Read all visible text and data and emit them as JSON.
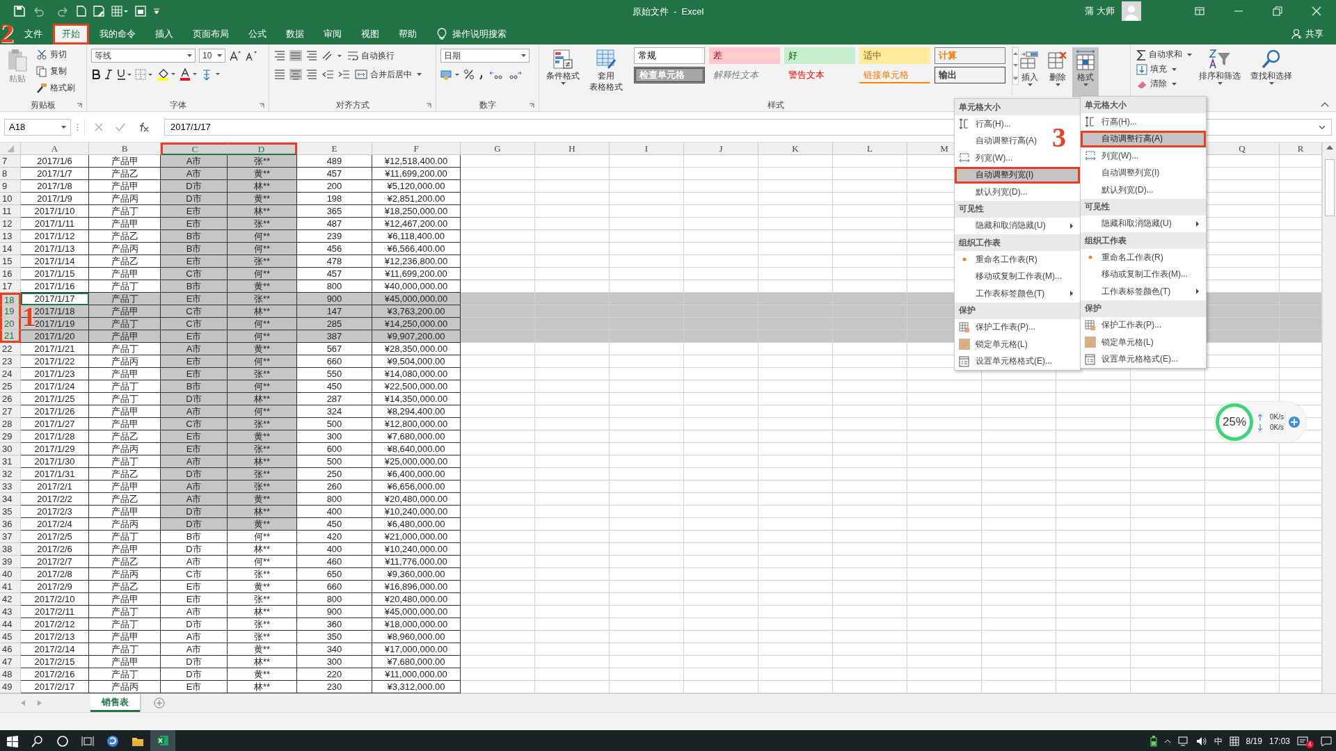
{
  "title_bar": {
    "document_title": "原始文件  -  Excel",
    "user": "蒲 大师"
  },
  "ribbon_tabs": [
    {
      "label": "文件",
      "selected": false
    },
    {
      "label": "开始",
      "selected": true
    },
    {
      "label": "我的命令",
      "selected": false
    },
    {
      "label": "插入",
      "selected": false
    },
    {
      "label": "页面布局",
      "selected": false
    },
    {
      "label": "公式",
      "selected": false
    },
    {
      "label": "数据",
      "selected": false
    },
    {
      "label": "审阅",
      "selected": false
    },
    {
      "label": "视图",
      "selected": false
    },
    {
      "label": "帮助",
      "selected": false
    }
  ],
  "tell_me": "操作说明搜索",
  "share": "共享",
  "ribbon": {
    "clipboard": {
      "paste": "粘贴",
      "cut": "剪切",
      "copy": "复制",
      "format_painter": "格式刷",
      "label": "剪贴板"
    },
    "font": {
      "name": "等线",
      "size": "10",
      "label": "字体"
    },
    "alignment": {
      "wrap_text": "自动换行",
      "merge_center": "合并后居中",
      "label": "对齐方式"
    },
    "number": {
      "format": "日期",
      "label": "数字"
    },
    "styles": {
      "conditional_formatting": "条件格式",
      "format_as_table": [
        "套用",
        "表格格式"
      ],
      "label": "样式",
      "gallery": [
        {
          "label": "常规",
          "kind": "normal"
        },
        {
          "label": "差",
          "kind": "bad"
        },
        {
          "label": "好",
          "kind": "good"
        },
        {
          "label": "适中",
          "kind": "neutral"
        },
        {
          "label": "计算",
          "kind": "calculation"
        },
        {
          "label": "检查单元格",
          "kind": "check"
        },
        {
          "label": "解释性文本",
          "kind": "explanatory"
        },
        {
          "label": "警告文本",
          "kind": "warning"
        },
        {
          "label": "链接单元格",
          "kind": "linked"
        },
        {
          "label": "输出",
          "kind": "output"
        }
      ]
    },
    "cells": [
      {
        "label": "插入",
        "selected": false
      },
      {
        "label": "删除",
        "selected": false
      },
      {
        "label": "格式",
        "selected": true
      }
    ],
    "editing": {
      "autosum": "自动求和",
      "fill": "填充",
      "clear": "清除",
      "sort_filter": "排序和筛选",
      "find_select": "查找和选择"
    }
  },
  "formula_bar": {
    "name_box": "A18",
    "formula": "2017/1/17"
  },
  "columns": [
    {
      "label": "A",
      "selected": false
    },
    {
      "label": "B",
      "selected": false
    },
    {
      "label": "C",
      "selected": true
    },
    {
      "label": "D",
      "selected": true
    },
    {
      "label": "E",
      "selected": false
    },
    {
      "label": "F",
      "selected": false
    },
    {
      "label": "G",
      "selected": false
    },
    {
      "label": "H",
      "selected": false
    },
    {
      "label": "I",
      "selected": false
    },
    {
      "label": "J",
      "selected": false
    },
    {
      "label": "K",
      "selected": false
    },
    {
      "label": "L",
      "selected": false
    },
    {
      "label": "M",
      "selected": false
    },
    {
      "label": "Q",
      "selected": false
    },
    {
      "label": "R",
      "selected": false
    }
  ],
  "rows": [
    {
      "number": "7",
      "cells": [
        "2017/1/6",
        "产品甲",
        "A市",
        "张**",
        "489",
        "¥12,518,400.00"
      ],
      "selected": false,
      "in_range": true,
      "active": false
    },
    {
      "number": "8",
      "cells": [
        "2017/1/7",
        "产品乙",
        "A市",
        "黄**",
        "457",
        "¥11,699,200.00"
      ],
      "selected": false,
      "in_range": true,
      "active": false
    },
    {
      "number": "9",
      "cells": [
        "2017/1/8",
        "产品甲",
        "D市",
        "林**",
        "200",
        "¥5,120,000.00"
      ],
      "selected": false,
      "in_range": true,
      "active": false
    },
    {
      "number": "10",
      "cells": [
        "2017/1/9",
        "产品丙",
        "D市",
        "黄**",
        "198",
        "¥2,851,200.00"
      ],
      "selected": false,
      "in_range": true,
      "active": false
    },
    {
      "number": "11",
      "cells": [
        "2017/1/10",
        "产品丁",
        "E市",
        "林**",
        "365",
        "¥18,250,000.00"
      ],
      "selected": false,
      "in_range": true,
      "active": false
    },
    {
      "number": "12",
      "cells": [
        "2017/1/11",
        "产品甲",
        "E市",
        "张**",
        "487",
        "¥12,467,200.00"
      ],
      "selected": false,
      "in_range": true,
      "active": false
    },
    {
      "number": "13",
      "cells": [
        "2017/1/12",
        "产品乙",
        "B市",
        "何**",
        "239",
        "¥6,118,400.00"
      ],
      "selected": false,
      "in_range": true,
      "active": false
    },
    {
      "number": "14",
      "cells": [
        "2017/1/13",
        "产品丙",
        "B市",
        "何**",
        "456",
        "¥6,566,400.00"
      ],
      "selected": false,
      "in_range": true,
      "active": false
    },
    {
      "number": "15",
      "cells": [
        "2017/1/14",
        "产品乙",
        "E市",
        "张**",
        "478",
        "¥12,236,800.00"
      ],
      "selected": false,
      "in_range": true,
      "active": false
    },
    {
      "number": "16",
      "cells": [
        "2017/1/15",
        "产品甲",
        "C市",
        "何**",
        "457",
        "¥11,699,200.00"
      ],
      "selected": false,
      "in_range": true,
      "active": false
    },
    {
      "number": "17",
      "cells": [
        "2017/1/16",
        "产品丁",
        "B市",
        "黄**",
        "800",
        "¥40,000,000.00"
      ],
      "selected": false,
      "in_range": true,
      "active": false
    },
    {
      "number": "18",
      "cells": [
        "2017/1/17",
        "产品丁",
        "E市",
        "张**",
        "900",
        "¥45,000,000.00"
      ],
      "selected": true,
      "in_range": true,
      "active": true
    },
    {
      "number": "19",
      "cells": [
        "2017/1/18",
        "产品甲",
        "C市",
        "林**",
        "147",
        "¥3,763,200.00"
      ],
      "selected": true,
      "in_range": true,
      "active": false
    },
    {
      "number": "20",
      "cells": [
        "2017/1/19",
        "产品丁",
        "C市",
        "何**",
        "285",
        "¥14,250,000.00"
      ],
      "selected": true,
      "in_range": true,
      "active": false
    },
    {
      "number": "21",
      "cells": [
        "2017/1/20",
        "产品甲",
        "E市",
        "何**",
        "387",
        "¥9,907,200.00"
      ],
      "selected": true,
      "in_range": true,
      "active": false
    },
    {
      "number": "22",
      "cells": [
        "2017/1/21",
        "产品丁",
        "A市",
        "黄**",
        "567",
        "¥28,350,000.00"
      ],
      "selected": false,
      "in_range": true,
      "active": false
    },
    {
      "number": "23",
      "cells": [
        "2017/1/22",
        "产品丙",
        "E市",
        "何**",
        "660",
        "¥9,504,000.00"
      ],
      "selected": false,
      "in_range": true,
      "active": false
    },
    {
      "number": "24",
      "cells": [
        "2017/1/23",
        "产品甲",
        "E市",
        "张**",
        "550",
        "¥14,080,000.00"
      ],
      "selected": false,
      "in_range": true,
      "active": false
    },
    {
      "number": "25",
      "cells": [
        "2017/1/24",
        "产品丁",
        "B市",
        "何**",
        "450",
        "¥22,500,000.00"
      ],
      "selected": false,
      "in_range": true,
      "active": false
    },
    {
      "number": "26",
      "cells": [
        "2017/1/25",
        "产品丁",
        "D市",
        "林**",
        "287",
        "¥14,350,000.00"
      ],
      "selected": false,
      "in_range": true,
      "active": false
    },
    {
      "number": "27",
      "cells": [
        "2017/1/26",
        "产品甲",
        "A市",
        "何**",
        "324",
        "¥8,294,400.00"
      ],
      "selected": false,
      "in_range": true,
      "active": false
    },
    {
      "number": "28",
      "cells": [
        "2017/1/27",
        "产品甲",
        "C市",
        "张**",
        "500",
        "¥12,800,000.00"
      ],
      "selected": false,
      "in_range": true,
      "active": false
    },
    {
      "number": "29",
      "cells": [
        "2017/1/28",
        "产品乙",
        "E市",
        "黄**",
        "300",
        "¥7,680,000.00"
      ],
      "selected": false,
      "in_range": true,
      "active": false
    },
    {
      "number": "30",
      "cells": [
        "2017/1/29",
        "产品丙",
        "E市",
        "张**",
        "600",
        "¥8,640,000.00"
      ],
      "selected": false,
      "in_range": true,
      "active": false
    },
    {
      "number": "31",
      "cells": [
        "2017/1/30",
        "产品丁",
        "A市",
        "林**",
        "500",
        "¥25,000,000.00"
      ],
      "selected": false,
      "in_range": true,
      "active": false
    },
    {
      "number": "32",
      "cells": [
        "2017/1/31",
        "产品乙",
        "D市",
        "张**",
        "250",
        "¥6,400,000.00"
      ],
      "selected": false,
      "in_range": true,
      "active": false
    },
    {
      "number": "33",
      "cells": [
        "2017/2/1",
        "产品甲",
        "A市",
        "张**",
        "260",
        "¥6,656,000.00"
      ],
      "selected": false,
      "in_range": true,
      "active": false
    },
    {
      "number": "34",
      "cells": [
        "2017/2/2",
        "产品乙",
        "A市",
        "黄**",
        "800",
        "¥20,480,000.00"
      ],
      "selected": false,
      "in_range": true,
      "active": false
    },
    {
      "number": "35",
      "cells": [
        "2017/2/3",
        "产品甲",
        "D市",
        "林**",
        "400",
        "¥10,240,000.00"
      ],
      "selected": false,
      "in_range": true,
      "active": false
    },
    {
      "number": "36",
      "cells": [
        "2017/2/4",
        "产品丙",
        "D市",
        "黄**",
        "450",
        "¥6,480,000.00"
      ],
      "selected": false,
      "in_range": true,
      "active": false
    },
    {
      "number": "37",
      "cells": [
        "2017/2/5",
        "产品丁",
        "B市",
        "何**",
        "420",
        "¥21,000,000.00"
      ],
      "selected": false,
      "in_range": false,
      "active": false
    },
    {
      "number": "38",
      "cells": [
        "2017/2/6",
        "产品甲",
        "D市",
        "林**",
        "400",
        "¥10,240,000.00"
      ],
      "selected": false,
      "in_range": false,
      "active": false
    },
    {
      "number": "39",
      "cells": [
        "2017/2/7",
        "产品乙",
        "A市",
        "何**",
        "460",
        "¥11,776,000.00"
      ],
      "selected": false,
      "in_range": false,
      "active": false
    },
    {
      "number": "40",
      "cells": [
        "2017/2/8",
        "产品丙",
        "C市",
        "张**",
        "650",
        "¥9,360,000.00"
      ],
      "selected": false,
      "in_range": false,
      "active": false
    },
    {
      "number": "41",
      "cells": [
        "2017/2/9",
        "产品乙",
        "E市",
        "黄**",
        "660",
        "¥16,896,000.00"
      ],
      "selected": false,
      "in_range": false,
      "active": false
    },
    {
      "number": "42",
      "cells": [
        "2017/2/10",
        "产品甲",
        "E市",
        "张**",
        "800",
        "¥20,480,000.00"
      ],
      "selected": false,
      "in_range": false,
      "active": false
    },
    {
      "number": "43",
      "cells": [
        "2017/2/11",
        "产品丁",
        "A市",
        "林**",
        "900",
        "¥45,000,000.00"
      ],
      "selected": false,
      "in_range": false,
      "active": false
    },
    {
      "number": "44",
      "cells": [
        "2017/2/12",
        "产品丁",
        "D市",
        "张**",
        "360",
        "¥18,000,000.00"
      ],
      "selected": false,
      "in_range": false,
      "active": false
    },
    {
      "number": "45",
      "cells": [
        "2017/2/13",
        "产品甲",
        "A市",
        "张**",
        "350",
        "¥8,960,000.00"
      ],
      "selected": false,
      "in_range": false,
      "active": false
    },
    {
      "number": "46",
      "cells": [
        "2017/2/14",
        "产品丁",
        "A市",
        "黄**",
        "340",
        "¥17,000,000.00"
      ],
      "selected": false,
      "in_range": false,
      "active": false
    },
    {
      "number": "47",
      "cells": [
        "2017/2/15",
        "产品甲",
        "D市",
        "林**",
        "300",
        "¥7,680,000.00"
      ],
      "selected": false,
      "in_range": false,
      "active": false
    },
    {
      "number": "48",
      "cells": [
        "2017/2/16",
        "产品丁",
        "D市",
        "黄**",
        "220",
        "¥11,000,000.00"
      ],
      "selected": false,
      "in_range": false,
      "active": false
    },
    {
      "number": "49",
      "cells": [
        "2017/2/17",
        "产品丙",
        "E市",
        "林**",
        "230",
        "¥3,312,000.00"
      ],
      "selected": false,
      "in_range": false,
      "active": false
    }
  ],
  "context_menus": [
    {
      "items": [
        {
          "kind": "header",
          "label": "单元格大小"
        },
        {
          "kind": "item",
          "label": "行高(H)...",
          "selected": false,
          "submenu": false
        },
        {
          "kind": "item",
          "label": "自动调整行高(A)",
          "selected": false,
          "submenu": false
        },
        {
          "kind": "item",
          "label": "列宽(W)...",
          "selected": false,
          "submenu": false
        },
        {
          "kind": "item",
          "label": "自动调整列宽(I)",
          "selected": true,
          "submenu": false
        },
        {
          "kind": "item",
          "label": "默认列宽(D)...",
          "selected": false,
          "submenu": false
        },
        {
          "kind": "header",
          "label": "可见性"
        },
        {
          "kind": "item",
          "label": "隐藏和取消隐藏(U)",
          "selected": false,
          "submenu": true
        },
        {
          "kind": "header",
          "label": "组织工作表"
        },
        {
          "kind": "item",
          "label": "重命名工作表(R)",
          "selected": false,
          "submenu": false
        },
        {
          "kind": "item",
          "label": "移动或复制工作表(M)...",
          "selected": false,
          "submenu": false
        },
        {
          "kind": "item",
          "label": "工作表标签颜色(T)",
          "selected": false,
          "submenu": true
        },
        {
          "kind": "header",
          "label": "保护"
        },
        {
          "kind": "item",
          "label": "保护工作表(P)...",
          "selected": false,
          "submenu": false
        },
        {
          "kind": "item",
          "label": "锁定单元格(L)",
          "selected": false,
          "submenu": false
        },
        {
          "kind": "item",
          "label": "设置单元格格式(E)...",
          "selected": false,
          "submenu": false
        }
      ]
    },
    {
      "items": [
        {
          "kind": "header",
          "label": "单元格大小"
        },
        {
          "kind": "item",
          "label": "行高(H)...",
          "selected": false,
          "submenu": false
        },
        {
          "kind": "item",
          "label": "自动调整行高(A)",
          "selected": true,
          "submenu": false
        },
        {
          "kind": "item",
          "label": "列宽(W)...",
          "selected": false,
          "submenu": false
        },
        {
          "kind": "item",
          "label": "自动调整列宽(I)",
          "selected": false,
          "submenu": false
        },
        {
          "kind": "item",
          "label": "默认列宽(D)...",
          "selected": false,
          "submenu": false
        },
        {
          "kind": "header",
          "label": "可见性"
        },
        {
          "kind": "item",
          "label": "隐藏和取消隐藏(U)",
          "selected": false,
          "submenu": true
        },
        {
          "kind": "header",
          "label": "组织工作表"
        },
        {
          "kind": "item",
          "label": "重命名工作表(R)",
          "selected": false,
          "submenu": false
        },
        {
          "kind": "item",
          "label": "移动或复制工作表(M)...",
          "selected": false,
          "submenu": false
        },
        {
          "kind": "item",
          "label": "工作表标签颜色(T)",
          "selected": false,
          "submenu": true
        },
        {
          "kind": "header",
          "label": "保护"
        },
        {
          "kind": "item",
          "label": "保护工作表(P)...",
          "selected": false,
          "submenu": false
        },
        {
          "kind": "item",
          "label": "锁定单元格(L)",
          "selected": false,
          "submenu": false
        },
        {
          "kind": "item",
          "label": "设置单元格格式(E)...",
          "selected": false,
          "submenu": false
        }
      ]
    }
  ],
  "sheet_tabs": [
    {
      "label": "销售表",
      "selected": true
    }
  ],
  "network_widget": {
    "percent": "25%",
    "upload": "0K/s",
    "download": "0K/s"
  },
  "taskbar": {
    "input_method": "中",
    "time": "17:03",
    "date": "8/19",
    "notifications": "4"
  },
  "annotations": [
    {
      "label": "2"
    },
    {
      "label": "1"
    },
    {
      "label": "3"
    }
  ]
}
